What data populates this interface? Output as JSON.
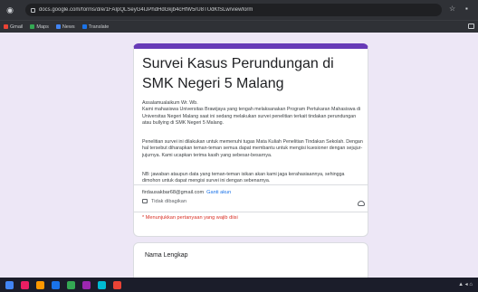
{
  "browser": {
    "url": "docs.google.com/forms/d/e/1FAIpQLSeyG4IJPhdHdGkjb4cHfW5rU8TUdKfSLw/viewform",
    "bookmarks": [
      {
        "label": "Gmail",
        "color": "#ea4335"
      },
      {
        "label": "Maps",
        "color": "#34a853"
      },
      {
        "label": "News",
        "color": "#4285f4"
      },
      {
        "label": "Translate",
        "color": "#1a73e8"
      }
    ]
  },
  "form": {
    "title": "Survei Kasus Perundungan di SMK Negeri 5 Malang",
    "paragraph1": "Assalamualaikum Wr. Wb.\nKami mahasiswa Universitas Brawijaya yang tengah melaksanakan Program Pertukaran Mahasiswa di Universitas Negeri Malang saat ini sedang melakukan survei penelitian terkait tindakan perundungan atau bullying di SMK Negeri 5 Malang.",
    "paragraph2": "Penelitian survei ini dilakukan untuk memenuhi tugas Mata Kuliah Penelitian Tindakan Sekolah. Dengan hal tersebut diharapkan teman-teman semua dapat membantu untuk mengisi kuesioner dengan sejujur-jujurnya. Kami ucapkan terima kasih yang sebesar-besarnya.",
    "paragraph3": "NB: jawaban ataupun data yang teman-teman isikan akan kami jaga kerahasiaannya, sehingga dimohon untuk dapat mengisi survei ini dengan sebenarnya.",
    "account_email": "firdausakbar68@gmail.com",
    "switch_account": "Ganti akun",
    "not_shared": "Tidak dibagikan",
    "required_note": "* Menunjukkan pertanyaan yang wajib diisi"
  },
  "question": {
    "label": "Nama Lengkap"
  },
  "taskbar": {
    "apps": [
      "#4285f4",
      "#e91e63",
      "#ff9800",
      "#1a73e8",
      "#34a853",
      "#9c27b0",
      "#00bcd4",
      "#ea4335"
    ]
  }
}
